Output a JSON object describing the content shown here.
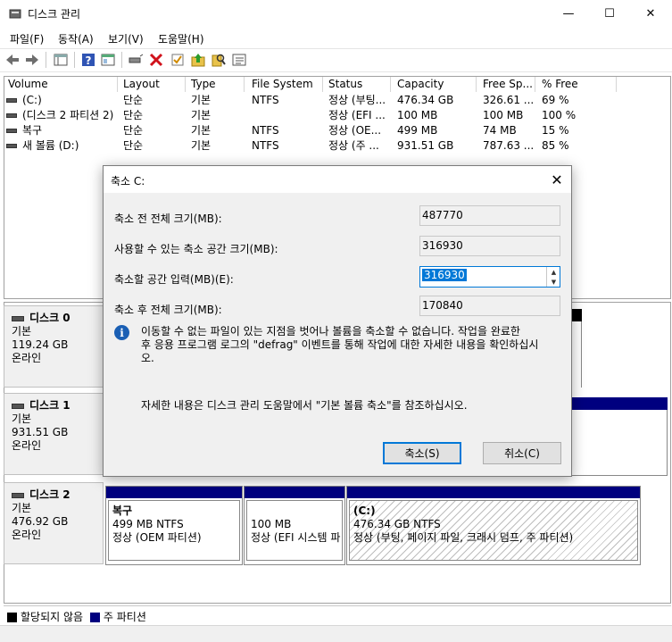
{
  "window": {
    "title": "디스크 관리",
    "minimize": "—",
    "maximize": "☐",
    "close": "✕"
  },
  "menu": [
    "파일(F)",
    "동작(A)",
    "보기(V)",
    "도움말(H)"
  ],
  "toolbar_icons": [
    "back-arrow-icon",
    "forward-arrow-icon",
    "console-tree-icon",
    "help-icon",
    "properties-icon",
    "connect-icon",
    "delete-icon",
    "check-icon",
    "up-folder-icon",
    "search-icon",
    "list-icon"
  ],
  "volumes": {
    "columns": [
      "Volume",
      "Layout",
      "Type",
      "File System",
      "Status",
      "Capacity",
      "Free Sp...",
      "% Free"
    ],
    "rows": [
      [
        "(C:)",
        "단순",
        "기본",
        "NTFS",
        "정상 (부팅...",
        "476.34 GB",
        "326.61 ...",
        "69 %"
      ],
      [
        "(디스크 2 파티션 2)",
        "단순",
        "기본",
        "",
        "정상 (EFI ...",
        "100 MB",
        "100 MB",
        "100 %"
      ],
      [
        "복구",
        "단순",
        "기본",
        "NTFS",
        "정상 (OE...",
        "499 MB",
        "74 MB",
        "15 %"
      ],
      [
        "새 볼륨 (D:)",
        "단순",
        "기본",
        "NTFS",
        "정상 (주 ...",
        "931.51 GB",
        "787.63 ...",
        "85 %"
      ]
    ]
  },
  "disks": [
    {
      "name": "디스크 0",
      "type": "기본",
      "size": "119.24 GB",
      "state": "온라인"
    },
    {
      "name": "디스크 1",
      "type": "기본",
      "size": "931.51 GB",
      "state": "온라인"
    },
    {
      "name": "디스크 2",
      "type": "기본",
      "size": "476.92 GB",
      "state": "온라인"
    }
  ],
  "disk2_partitions": [
    {
      "name": "복구",
      "size": "499 MB NTFS",
      "status": "정상 (OEM 파티션)"
    },
    {
      "name": "",
      "size": "100 MB",
      "status": "정상 (EFI 시스템 파"
    },
    {
      "name": "(C:)",
      "size": "476.34 GB NTFS",
      "status": "정상 (부팅, 페이지 파일, 크래시 덤프, 주 파티션)"
    }
  ],
  "legend": {
    "unallocated": "할당되지 않음",
    "primary": "주 파티션",
    "unallocated_color": "#000000",
    "primary_color": "#00007f"
  },
  "dialog": {
    "title": "축소 C:",
    "total_before_label": "축소 전 전체 크기(MB):",
    "total_before_value": "487770",
    "available_label": "사용할 수 있는 축소 공간 크기(MB):",
    "available_value": "316930",
    "amount_label": "축소할 공간 입력(MB)(E):",
    "amount_value": "316930",
    "total_after_label": "축소 후 전체 크기(MB):",
    "total_after_value": "170840",
    "info_line1": "이동할 수 없는 파일이 있는 지점을 벗어나 볼륨을 축소할 수 없습니다. 작업을 완료한",
    "info_line2": "후 응용 프로그램 로그의 \"defrag\" 이벤트를 통해 작업에 대한 자세한 내용을 확인하십시",
    "info_line3": "오.",
    "help_text": "자세한 내용은 디스크 관리 도움말에서 \"기본 볼륨 축소\"를 참조하십시오.",
    "ok_label": "축소(S)",
    "cancel_label": "취소(C)"
  }
}
